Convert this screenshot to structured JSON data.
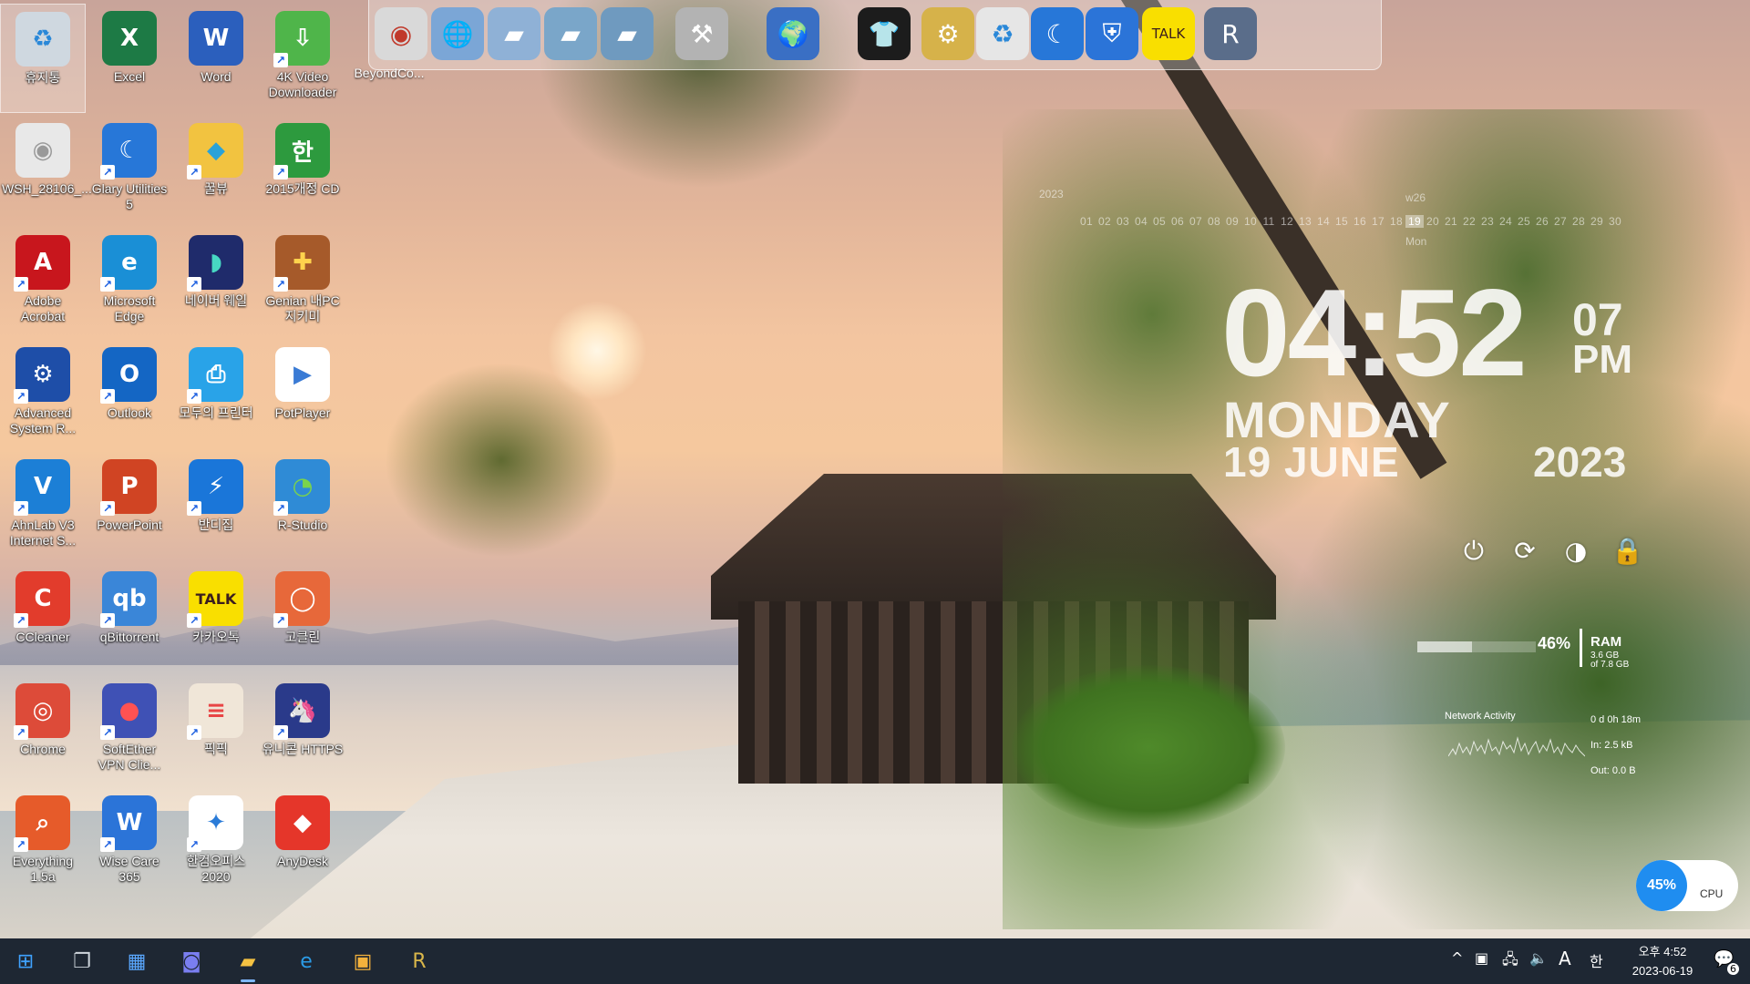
{
  "desktop_icons": [
    {
      "label": "휴지통",
      "glyph": "♻",
      "bg": "#cfd8e0",
      "fg": "#2a88d8",
      "shortcut": false,
      "selected": true
    },
    {
      "label": "Excel",
      "glyph": "X",
      "bg": "#1d7a45",
      "fg": "#ffffff",
      "shortcut": false
    },
    {
      "label": "Word",
      "glyph": "W",
      "bg": "#2b5fbd",
      "fg": "#ffffff",
      "shortcut": false
    },
    {
      "label": "4K Video Downloader",
      "glyph": "⇩",
      "bg": "#4fb54a",
      "fg": "#ffffff",
      "shortcut": true
    },
    {
      "label": "WSH_28106_...",
      "glyph": "◉",
      "bg": "#e8e8e8",
      "fg": "#999999",
      "shortcut": false
    },
    {
      "label": "Glary Utilities 5",
      "glyph": "☾",
      "bg": "#2777d8",
      "fg": "#ffffff",
      "shortcut": true
    },
    {
      "label": "꿀뷰",
      "glyph": "◆",
      "bg": "#f2c340",
      "fg": "#2aa2d9",
      "shortcut": true
    },
    {
      "label": "2015개정 CD",
      "glyph": "한",
      "bg": "#2d9a3e",
      "fg": "#ffffff",
      "shortcut": true
    },
    {
      "label": "Adobe Acrobat",
      "glyph": "A",
      "bg": "#c8161d",
      "fg": "#ffffff",
      "shortcut": true
    },
    {
      "label": "Microsoft Edge",
      "glyph": "e",
      "bg": "#1a8fd6",
      "fg": "#ffffff",
      "shortcut": true
    },
    {
      "label": "네이버 웨일",
      "glyph": "◗",
      "bg": "#1f2b6b",
      "fg": "#47d8c3",
      "shortcut": true
    },
    {
      "label": "Genian 내PC지키미",
      "glyph": "✚",
      "bg": "#a65a2a",
      "fg": "#ffd34d",
      "shortcut": true
    },
    {
      "label": "Advanced System R...",
      "glyph": "⚙",
      "bg": "#1e4ea8",
      "fg": "#ffffff",
      "shortcut": true
    },
    {
      "label": "Outlook",
      "glyph": "O",
      "bg": "#1466c4",
      "fg": "#ffffff",
      "shortcut": true
    },
    {
      "label": "모두의 프린터",
      "glyph": "⎙",
      "bg": "#29a3e8",
      "fg": "#ffffff",
      "shortcut": true
    },
    {
      "label": "PotPlayer",
      "glyph": "▶",
      "bg": "#ffffff",
      "fg": "#3a7bd5",
      "shortcut": false
    },
    {
      "label": "AhnLab V3 Internet S...",
      "glyph": "V",
      "bg": "#1c7fd6",
      "fg": "#ffffff",
      "shortcut": true
    },
    {
      "label": "PowerPoint",
      "glyph": "P",
      "bg": "#d04423",
      "fg": "#ffffff",
      "shortcut": true
    },
    {
      "label": "반디집",
      "glyph": "⚡",
      "bg": "#1a76d9",
      "fg": "#ffffff",
      "shortcut": true
    },
    {
      "label": "R-Studio",
      "glyph": "◔",
      "bg": "#2f8bd6",
      "fg": "#7ad34d",
      "shortcut": true
    },
    {
      "label": "CCleaner",
      "glyph": "C",
      "bg": "#e23c2c",
      "fg": "#ffffff",
      "shortcut": true
    },
    {
      "label": "qBittorrent",
      "glyph": "qb",
      "bg": "#3a86d8",
      "fg": "#ffffff",
      "shortcut": true
    },
    {
      "label": "카카오톡",
      "glyph": "TALK",
      "bg": "#f9df00",
      "fg": "#3b1e1e",
      "shortcut": true
    },
    {
      "label": "고클린",
      "glyph": "◯",
      "bg": "#e7683a",
      "fg": "#ffffff",
      "shortcut": true
    },
    {
      "label": "Chrome",
      "glyph": "◎",
      "bg": "#dd4b39",
      "fg": "#ffffff",
      "shortcut": true
    },
    {
      "label": "SoftEther VPN Clie...",
      "glyph": "●",
      "bg": "#3f51b5",
      "fg": "#ff5252",
      "shortcut": true
    },
    {
      "label": "픽픽",
      "glyph": "≡",
      "bg": "#f0e6d8",
      "fg": "#e84545",
      "shortcut": true
    },
    {
      "label": "유니콘 HTTPS",
      "glyph": "🦄",
      "bg": "#2a3a8a",
      "fg": "#ffffff",
      "shortcut": true
    },
    {
      "label": "Everything 1.5a",
      "glyph": "⌕",
      "bg": "#e65b2a",
      "fg": "#ffffff",
      "shortcut": true
    },
    {
      "label": "Wise Care 365",
      "glyph": "W",
      "bg": "#2b74d8",
      "fg": "#ffffff",
      "shortcut": true
    },
    {
      "label": "한컴오피스 2020",
      "glyph": "✦",
      "bg": "#ffffff",
      "fg": "#2a7bd8",
      "shortcut": true
    },
    {
      "label": "AnyDesk",
      "glyph": "◆",
      "bg": "#e5362a",
      "fg": "#ffffff",
      "shortcut": false
    }
  ],
  "beyond_label": "BeyondCo...",
  "dock": [
    {
      "name": "cd-dvd-icon",
      "glyph": "◉",
      "bg": "#d9d9d9",
      "fg": "#c0392b"
    },
    {
      "name": "network-globe-icon",
      "glyph": "🌐",
      "bg": "#7ba6d6",
      "fg": "#ffffff"
    },
    {
      "name": "folder-documents-icon",
      "glyph": "▰",
      "bg": "#8fb1d6",
      "fg": "#ffffff"
    },
    {
      "name": "folder-green-icon",
      "glyph": "▰",
      "bg": "#7aa6c9",
      "fg": "#ffffff"
    },
    {
      "name": "folder-drive-icon",
      "glyph": "▰",
      "bg": "#6f9abf",
      "fg": "#ffffff"
    },
    {
      "name": "tools-hammer-icon",
      "glyph": "⚒",
      "bg": "#b3b3b3",
      "fg": "#ffffff"
    },
    {
      "name": "globe-earth-icon",
      "glyph": "🌍",
      "bg": "#3a6fc4",
      "fg": "#ffffff"
    },
    {
      "name": "tshirt-icon",
      "glyph": "👕",
      "bg": "#1c1c1c",
      "fg": "#ffffff"
    },
    {
      "name": "settings-tools-icon",
      "glyph": "⚙",
      "bg": "#d6b24a",
      "fg": "#ffffff"
    },
    {
      "name": "recycle-bin-icon",
      "glyph": "♻",
      "bg": "#e6e6e6",
      "fg": "#2a88d8"
    },
    {
      "name": "glary-moon-icon",
      "glyph": "☾",
      "bg": "#2777d8",
      "fg": "#ffffff"
    },
    {
      "name": "wise-shield-icon",
      "glyph": "⛨",
      "bg": "#2b74d8",
      "fg": "#ffffff"
    },
    {
      "name": "kakaotalk-icon",
      "glyph": "TALK",
      "bg": "#f9df00",
      "fg": "#3b1e1e"
    },
    {
      "name": "r-studio-drive-icon",
      "glyph": "R",
      "bg": "#5a6d8a",
      "fg": "#ffffff"
    }
  ],
  "calendar": {
    "year": "2023",
    "week": "w26",
    "days": [
      "01",
      "02",
      "03",
      "04",
      "05",
      "06",
      "07",
      "08",
      "09",
      "10",
      "11",
      "12",
      "13",
      "14",
      "15",
      "16",
      "17",
      "18",
      "19",
      "20",
      "21",
      "22",
      "23",
      "24",
      "25",
      "26",
      "27",
      "28",
      "29",
      "30"
    ],
    "today": "19",
    "dow": "Mon"
  },
  "clock": {
    "hm": "04:52",
    "sec": "07",
    "ampm": "PM",
    "day": "MONDAY",
    "date": "19 JUNE",
    "year": "2023"
  },
  "ram": {
    "percent_label": "46%",
    "percent": 46,
    "label": "RAM",
    "used": "3.6 GB",
    "total": "of 7.8 GB"
  },
  "network": {
    "title": "Network Activity",
    "uptime": "0 d 0h 18m",
    "in": "In: 2.5 kB",
    "out": "Out: 0.0 B"
  },
  "cpu": {
    "percent_label": "45%",
    "label": "CPU"
  },
  "taskbar": {
    "apps": [
      {
        "name": "start-button",
        "glyph": "⊞",
        "color": "#3fa2ff"
      },
      {
        "name": "task-view-button",
        "glyph": "❐",
        "color": "#cfd6dd"
      },
      {
        "name": "widgets-button",
        "glyph": "▦",
        "color": "#5aa8ff"
      },
      {
        "name": "teams-chat-button",
        "glyph": "◙",
        "color": "#7a7ef0"
      },
      {
        "name": "file-explorer-button",
        "glyph": "▰",
        "color": "#f5c242",
        "active": true
      },
      {
        "name": "edge-button",
        "glyph": "e",
        "color": "#2b9be6"
      },
      {
        "name": "store-button",
        "glyph": "▣",
        "color": "#f4b23c"
      },
      {
        "name": "r-app-button",
        "glyph": "R",
        "color": "#d9b64a"
      }
    ],
    "tray": {
      "chevron": "^",
      "ime_a": "A",
      "ime_han": "한",
      "time": "오후 4:52",
      "date": "2023-06-19",
      "notif_count": "6"
    }
  }
}
